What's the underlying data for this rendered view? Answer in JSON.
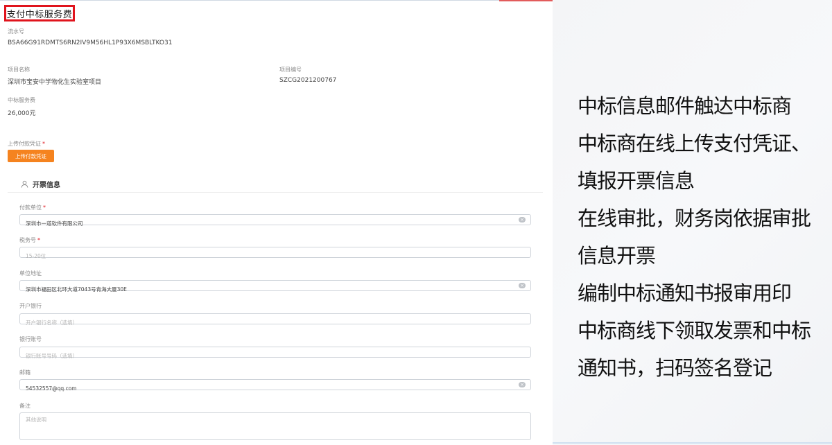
{
  "form": {
    "title": "支付中标服务费",
    "serial": {
      "label": "流水号",
      "value": "BSA66G91RDMTS6RN2IV9M56HL1P93X6MSBLTKO31"
    },
    "project_name": {
      "label": "项目名称",
      "value": "深圳市宝安中学物化生实验室项目"
    },
    "project_code": {
      "label": "项目编号",
      "value": "SZCG2021200767"
    },
    "fee": {
      "label": "中标服务费",
      "value": "26,000元"
    },
    "upload": {
      "label": "上传付款凭证",
      "required_mark": "*",
      "button": "上传付款凭证"
    },
    "invoice": {
      "section_title": "开票信息",
      "payer": {
        "label": "付款单位",
        "required_mark": "*",
        "value": "深圳市一道软件有限公司"
      },
      "tax_no": {
        "label": "税务号",
        "required_mark": "*",
        "placeholder": "15-20位"
      },
      "address": {
        "label": "单位地址",
        "value": "深圳市福田区北环大道7043号青海大厦30E"
      },
      "bank": {
        "label": "开户银行",
        "placeholder": "开户银行名称（选填）"
      },
      "account": {
        "label": "银行账号",
        "placeholder": "银行账号号码（选填）"
      },
      "email": {
        "label": "邮箱",
        "value": "54532557@qq.com"
      },
      "remark": {
        "label": "备注",
        "placeholder": "其他说明"
      }
    }
  },
  "notes": [
    "中标信息邮件触达中标商",
    "中标商在线上传支付凭证、",
    "填报开票信息",
    "在线审批，财务岗依据审批",
    "信息开票",
    "编制中标通知书报审用印",
    "中标商线下领取发票和中标",
    "通知书，扫码签名登记"
  ],
  "colors": {
    "accent": "#f5831f",
    "highlight": "#e0141d"
  }
}
